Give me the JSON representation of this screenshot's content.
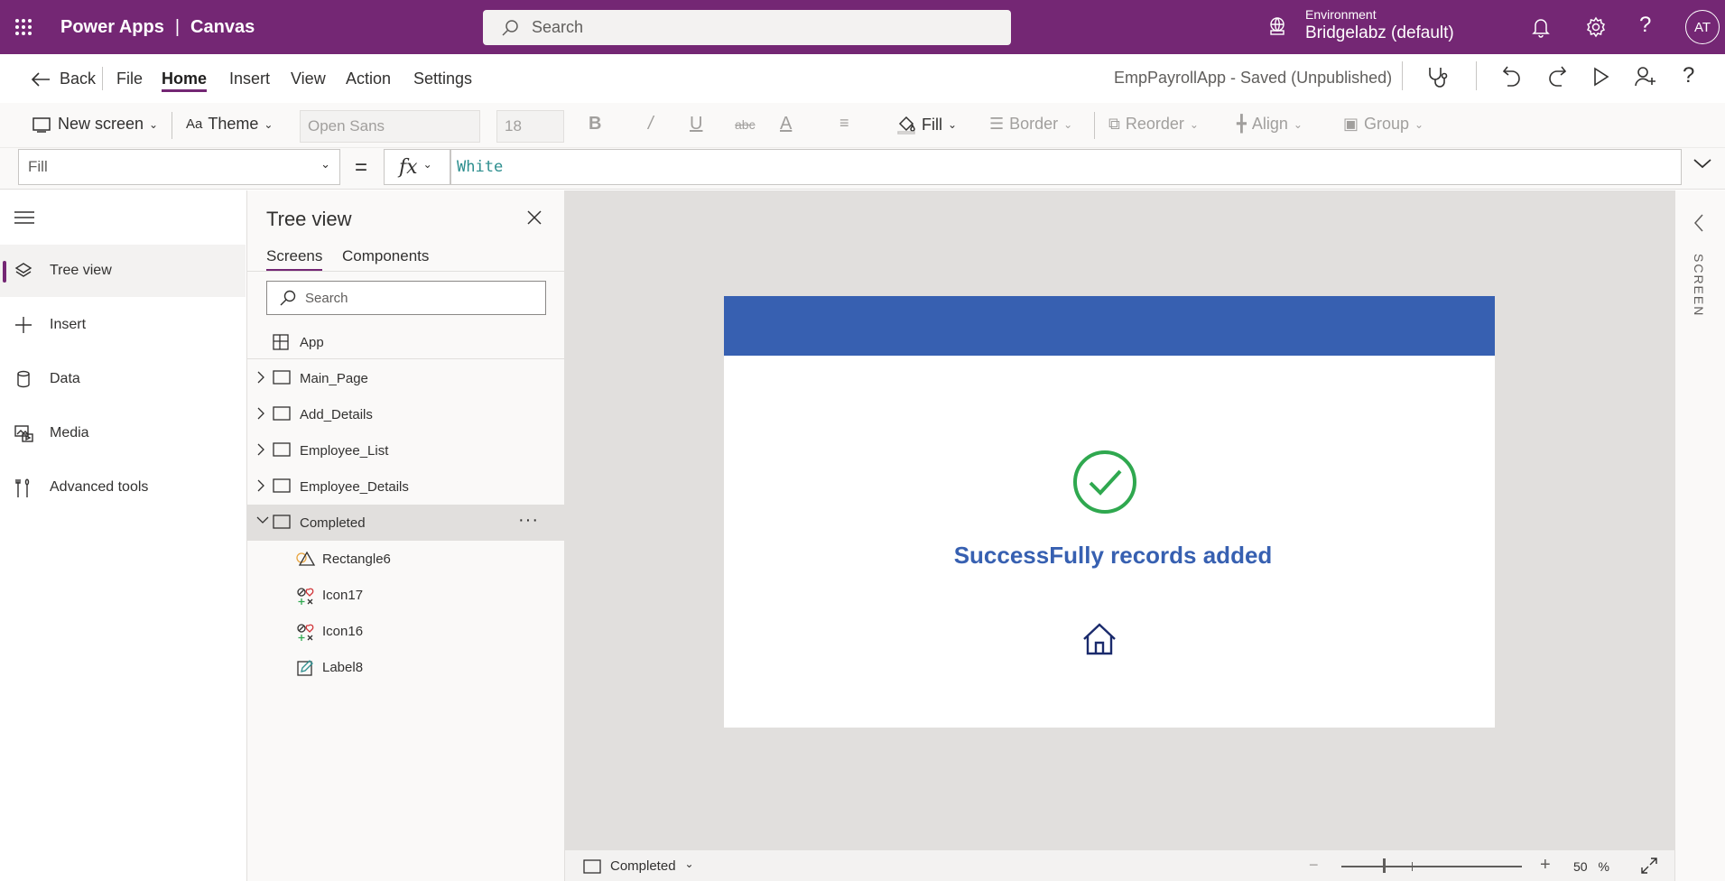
{
  "topbar": {
    "app_name": "Power Apps",
    "separator": "|",
    "mode": "Canvas",
    "search_placeholder": "Search",
    "environment_label": "Environment",
    "environment_value": "Bridgelabz (default)",
    "avatar_initials": "AT"
  },
  "menu": {
    "back": "Back",
    "items": [
      "File",
      "Home",
      "Insert",
      "View",
      "Action",
      "Settings"
    ],
    "active": "Home",
    "app_status": "EmpPayrollApp - Saved (Unpublished)"
  },
  "toolbar": {
    "new_screen": "New screen",
    "theme": "Theme",
    "font": "Open Sans",
    "font_size": "18",
    "fill": "Fill",
    "border": "Border",
    "reorder": "Reorder",
    "align": "Align",
    "group": "Group"
  },
  "formula": {
    "property": "Fill",
    "equals": "=",
    "fx": "fx",
    "value": "White"
  },
  "leftnav": {
    "items": [
      {
        "label": "Tree view",
        "icon": "layers-icon",
        "selected": true
      },
      {
        "label": "Insert",
        "icon": "plus-icon",
        "selected": false
      },
      {
        "label": "Data",
        "icon": "database-icon",
        "selected": false
      },
      {
        "label": "Media",
        "icon": "media-icon",
        "selected": false
      },
      {
        "label": "Advanced tools",
        "icon": "tools-icon",
        "selected": false
      }
    ]
  },
  "tree": {
    "title": "Tree view",
    "tabs": [
      "Screens",
      "Components"
    ],
    "active_tab": "Screens",
    "search_placeholder": "Search",
    "app_item": "App",
    "screens": [
      "Main_Page",
      "Add_Details",
      "Employee_List",
      "Employee_Details",
      "Completed"
    ],
    "selected_screen": "Completed",
    "more": "···",
    "children": [
      {
        "label": "Rectangle6",
        "icon": "shapes-icon"
      },
      {
        "label": "Icon17",
        "icon": "icons-icon"
      },
      {
        "label": "Icon16",
        "icon": "icons-icon"
      },
      {
        "label": "Label8",
        "icon": "label-edit-icon"
      }
    ]
  },
  "canvas": {
    "header_color": "#3760b1",
    "success_text": "SuccessFully records added",
    "check_color": "#2fa84f",
    "home_icon_color": "#1a2a6c"
  },
  "rightpanel": {
    "label": "SCREEN"
  },
  "statusbar": {
    "screen_name": "Completed",
    "zoom_minus": "−",
    "zoom_plus": "+",
    "zoom_value": "50",
    "zoom_unit": "%"
  },
  "colors": {
    "brand": "#742774",
    "accent_blue": "#3760b1"
  }
}
